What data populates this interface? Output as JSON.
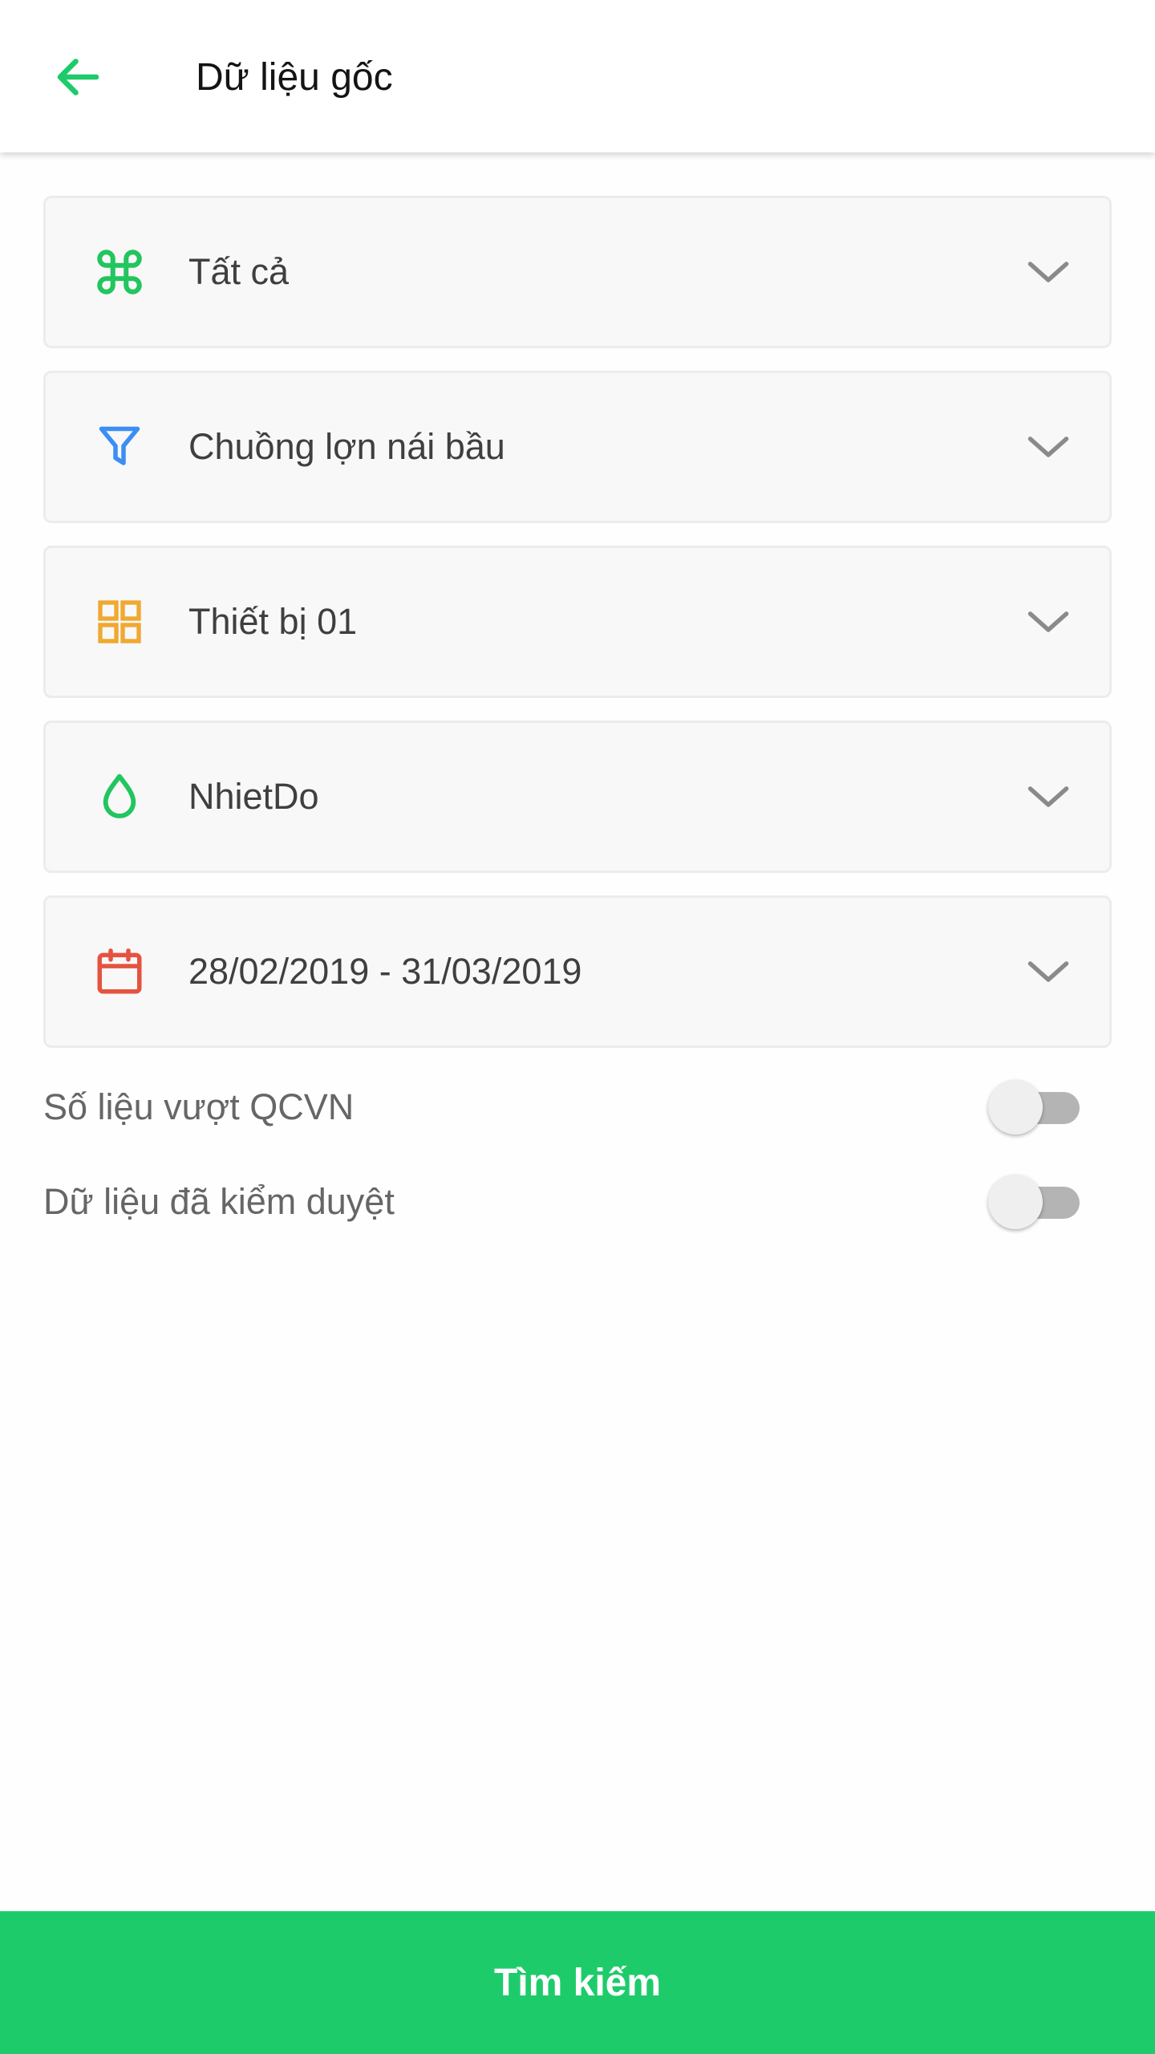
{
  "header": {
    "title": "Dữ liệu gốc",
    "back_icon": "arrow-left-icon"
  },
  "colors": {
    "accent_green": "#1ecb6b",
    "command_icon": "#22c55e",
    "filter_icon": "#3b8ef3",
    "grid_icon": "#f0a830",
    "drop_icon": "#22c55e",
    "calendar_icon": "#e55340",
    "chevron": "#8a8a8a"
  },
  "filters": [
    {
      "icon": "command-icon",
      "value": "Tất cả"
    },
    {
      "icon": "filter-funnel-icon",
      "value": "Chuồng lợn nái bầu"
    },
    {
      "icon": "grid-icon",
      "value": "Thiết bị 01"
    },
    {
      "icon": "water-drop-icon",
      "value": "NhietDo"
    },
    {
      "icon": "calendar-icon",
      "value": "28/02/2019 - 31/03/2019"
    }
  ],
  "toggles": [
    {
      "label": "Số liệu vượt QCVN",
      "state": "off"
    },
    {
      "label": "Dữ liệu đã kiểm duyệt",
      "state": "off"
    }
  ],
  "search_button": {
    "label": "Tìm kiếm"
  }
}
